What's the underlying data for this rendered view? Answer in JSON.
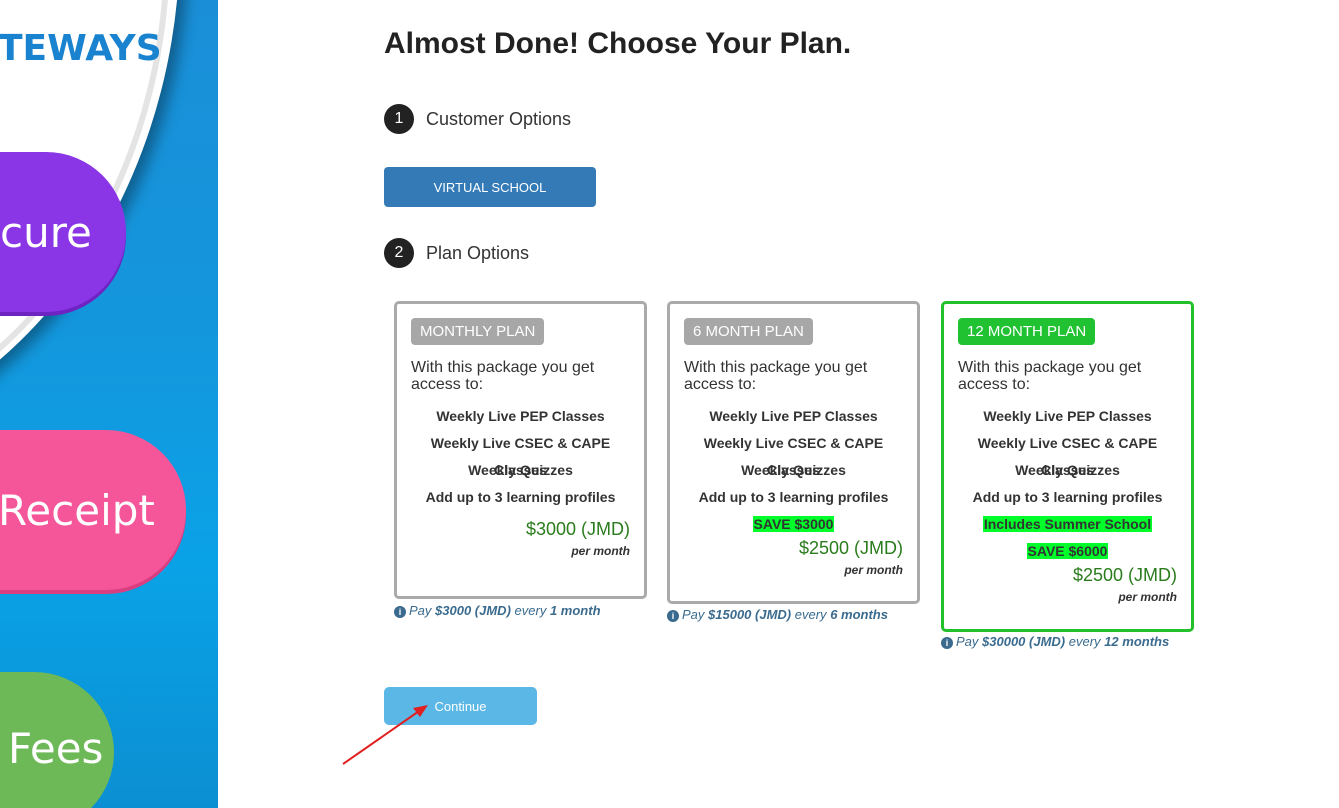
{
  "sidebar": {
    "brand_text": "TEWAYS",
    "pills": [
      {
        "label": "cure",
        "color": "#8a35e6"
      },
      {
        "label": "Receipt",
        "color": "#f5569a"
      },
      {
        "label": "Fees",
        "color": "#6db857"
      }
    ]
  },
  "page": {
    "title": "Almost Done! Choose Your Plan."
  },
  "steps": [
    {
      "number": "1",
      "label": "Customer Options"
    },
    {
      "number": "2",
      "label": "Plan Options"
    }
  ],
  "customer_option_button": "VIRTUAL SCHOOL",
  "plans": [
    {
      "badge": "MONTHLY PLAN",
      "intro": "With this package you get access to:",
      "features": [
        "Weekly Live PEP Classes",
        "Weekly Live CSEC & CAPE Classes",
        "Weekly Quizzes",
        "Add up to 3 learning profiles"
      ],
      "highlights": [],
      "price": "$3000 (JMD)",
      "per": "per month",
      "pay_prefix": "Pay",
      "pay_amount": "$3000 (JMD)",
      "pay_every": "every",
      "pay_period": "1 month",
      "selected": false
    },
    {
      "badge": "6 MONTH PLAN",
      "intro": "With this package you get access to:",
      "features": [
        "Weekly Live PEP Classes",
        "Weekly Live CSEC & CAPE Classes",
        "Weekly Quizzes",
        "Add up to 3 learning profiles"
      ],
      "highlights": [
        "SAVE $3000"
      ],
      "price": "$2500 (JMD)",
      "per": "per month",
      "pay_prefix": "Pay",
      "pay_amount": "$15000 (JMD)",
      "pay_every": "every",
      "pay_period": "6 months",
      "selected": false
    },
    {
      "badge": "12 MONTH PLAN",
      "intro": "With this package you get access to:",
      "features": [
        "Weekly Live PEP Classes",
        "Weekly Live CSEC & CAPE Classes",
        "Weekly Quizzes",
        "Add up to 3 learning profiles"
      ],
      "highlights": [
        "Includes Summer School",
        "SAVE $6000"
      ],
      "price": "$2500 (JMD)",
      "per": "per month",
      "pay_prefix": "Pay",
      "pay_amount": "$30000 (JMD)",
      "pay_every": "every",
      "pay_period": "12 months",
      "selected": true
    }
  ],
  "continue_button": "Continue",
  "colors": {
    "selected_border": "#22c02a",
    "highlight": "#00ff2a",
    "price": "#2a7c1c",
    "primary_button": "#337ab7",
    "continue_button": "#5bb7e6",
    "annotation_arrow": "#e02020"
  }
}
